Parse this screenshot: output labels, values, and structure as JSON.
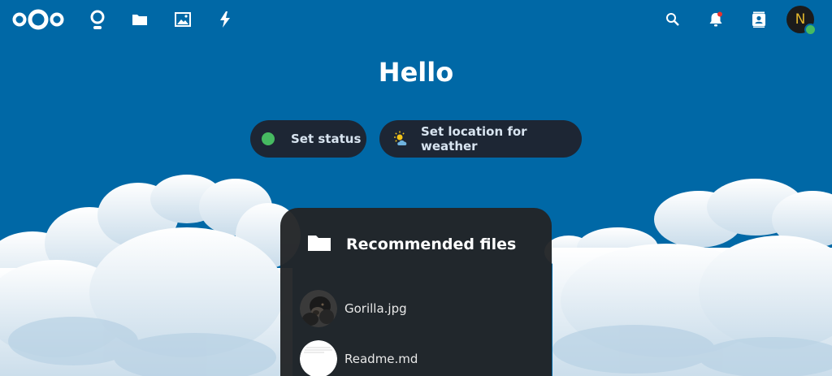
{
  "header": {
    "apps": [
      {
        "name": "dashboard",
        "icon": "dashboard-icon"
      },
      {
        "name": "files",
        "icon": "folder-icon"
      },
      {
        "name": "photos",
        "icon": "image-icon"
      },
      {
        "name": "activity",
        "icon": "lightning-icon"
      }
    ],
    "right_icons": [
      "search-icon",
      "notifications-bell-icon",
      "contacts-icon"
    ],
    "avatar_initial": "N"
  },
  "greeting": "Hello",
  "status_button": {
    "label": "Set status"
  },
  "weather_button": {
    "label": "Set location for weather"
  },
  "recommended_files": {
    "title": "Recommended files",
    "items": [
      {
        "name": "Gorilla.jpg"
      },
      {
        "name": "Readme.md"
      }
    ]
  },
  "colors": {
    "background": "#0068a6",
    "pill": "#1d2634",
    "status_online": "#46ba61",
    "panel": "#222426"
  }
}
